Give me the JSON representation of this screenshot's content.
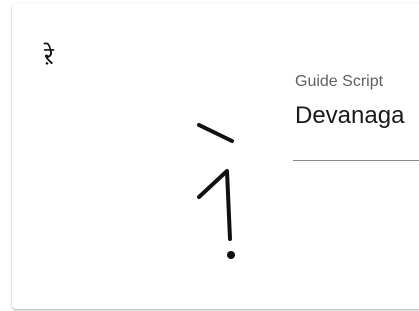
{
  "card": {
    "small_glyph": "ऱे",
    "large_glyph_icon": "devanagari-stroke-glyph"
  },
  "guide_script": {
    "label": "Guide Script",
    "value": "Devanaga"
  }
}
